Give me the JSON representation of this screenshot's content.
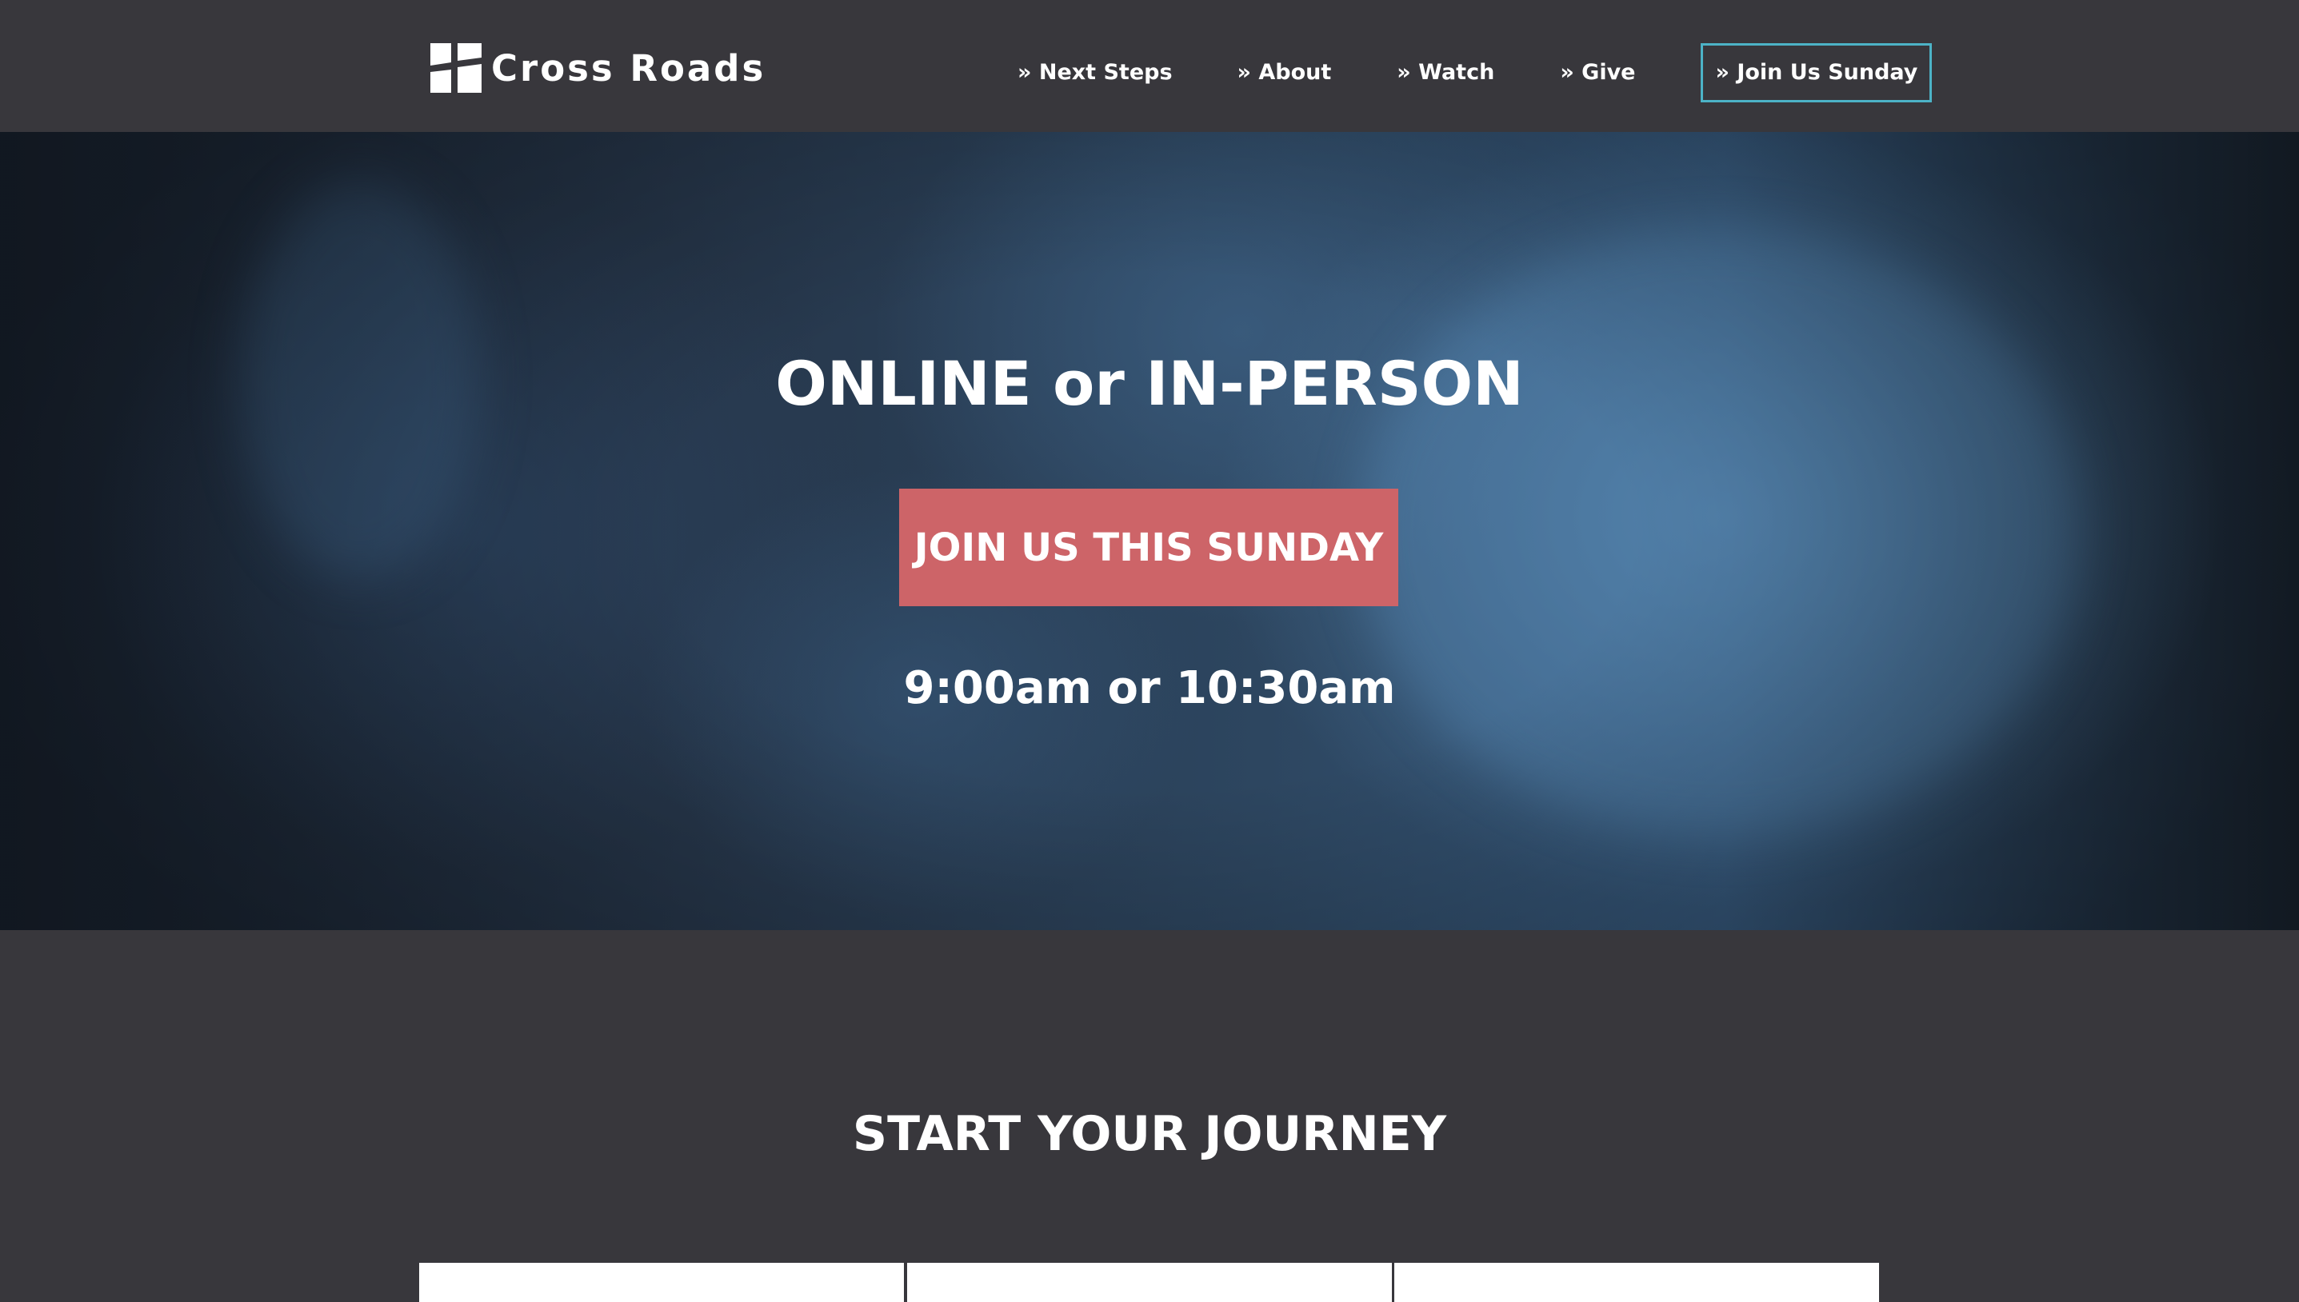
{
  "header": {
    "logo_text": "Cross Roads",
    "logo_icon": "cross-roads-logo-icon",
    "nav": [
      {
        "label": "» Next Steps"
      },
      {
        "label": "» About"
      },
      {
        "label": "» Watch"
      },
      {
        "label": "» Give"
      },
      {
        "label": "» Join Us Sunday"
      }
    ],
    "cta_border_color": "#4cb3c7"
  },
  "hero": {
    "title": "ONLINE or IN-PERSON",
    "button_label": "JOIN US THIS SUNDAY",
    "button_color": "#cd6468",
    "times": "9:00am or 10:30am"
  },
  "journey": {
    "title": "START YOUR JOURNEY",
    "card_count_visible": 3
  },
  "colors": {
    "background": "#38373c",
    "text": "#ffffff"
  }
}
